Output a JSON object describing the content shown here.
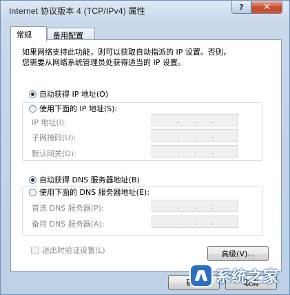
{
  "window": {
    "title": "Internet 协议版本 4 (TCP/IPv4) 属性",
    "help_glyph": "?",
    "close_glyph": "✕"
  },
  "tabs": [
    {
      "label": "常规",
      "active": true
    },
    {
      "label": "备用配置",
      "active": false
    }
  ],
  "general": {
    "description_line1": "如果网络支持此功能，则可以获取自动指派的 IP 设置。否则，",
    "description_line2": "您需要从网络系统管理员处获得适当的 IP 设置。",
    "ip": {
      "auto_label": "自动获得 IP 地址(O)",
      "auto_selected": true,
      "manual_label": "使用下面的 IP 地址(S):",
      "manual_selected": false,
      "fields": [
        {
          "label": "IP 地址(I):",
          "value": ""
        },
        {
          "label": "子网掩码(U):",
          "value": ""
        },
        {
          "label": "默认网关(D):",
          "value": ""
        }
      ]
    },
    "dns": {
      "auto_label": "自动获得 DNS 服务器地址(B)",
      "auto_selected": true,
      "manual_label": "使用下面的 DNS 服务器地址(E):",
      "manual_selected": false,
      "fields": [
        {
          "label": "首选 DNS 服务器(P):",
          "value": ""
        },
        {
          "label": "备用 DNS 服务器(A):",
          "value": ""
        }
      ]
    },
    "validate_label": "退出时验证设置(L)",
    "validate_checked": false,
    "advanced_label": "高级(V)..."
  },
  "footer": {
    "ok_label": "确定",
    "cancel_label": "取消"
  },
  "watermark": {
    "text": "系统之家"
  },
  "colors": {
    "close_button": "#c8472b",
    "panel_bg": "#ffffff",
    "disabled_text": "#8d8d8d"
  }
}
